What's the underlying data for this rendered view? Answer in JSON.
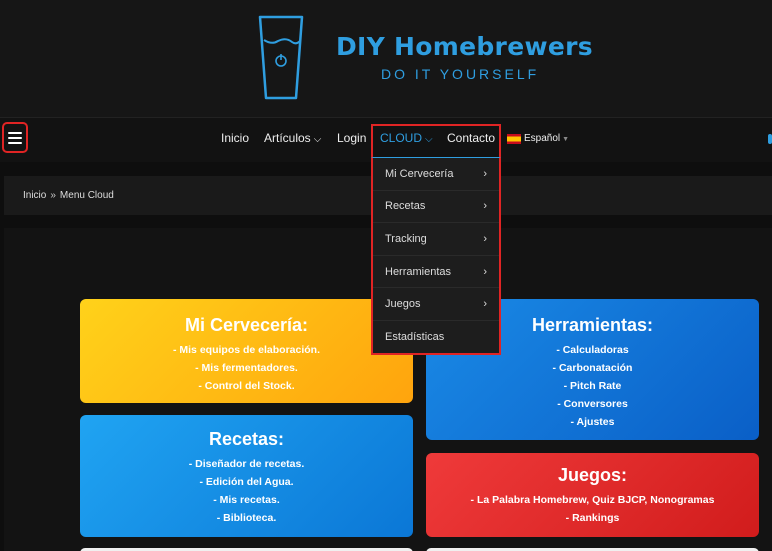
{
  "brand": {
    "title": "DIY Homebrewers",
    "tagline": "DO IT YOURSELF"
  },
  "nav": {
    "items": [
      "Inicio",
      "Artículos",
      "Login",
      "CLOUD",
      "Contacto"
    ],
    "language": "Español"
  },
  "breadcrumb": {
    "home": "Inicio",
    "current": "Menu Cloud"
  },
  "dropdown": {
    "items": [
      "Mi Cervecería",
      "Recetas",
      "Tracking",
      "Herramientas",
      "Juegos",
      "Estadísticas"
    ]
  },
  "cards": {
    "cerveceria": {
      "title": "Mi Cervecería:",
      "items": [
        "- Mis equipos de elaboración.",
        "- Mis fermentadores.",
        "- Control del Stock."
      ]
    },
    "herramientas": {
      "title": "Herramientas:",
      "items": [
        "- Calculadoras",
        "- Carbonatación",
        "- Pitch Rate",
        "- Conversores",
        "- Ajustes"
      ]
    },
    "recetas": {
      "title": "Recetas:",
      "items": [
        "- Diseñador de recetas.",
        "- Edición del Agua.",
        "- Mis recetas.",
        "- Biblioteca."
      ]
    },
    "juegos": {
      "title": "Juegos:",
      "items": [
        "- La Palabra Homebrew, Quiz BJCP, Nonogramas",
        "- Rankings"
      ]
    }
  },
  "colors": {
    "accent": "#2f9ee0",
    "highlight": "#e02424",
    "background": "#0e0e0e"
  }
}
